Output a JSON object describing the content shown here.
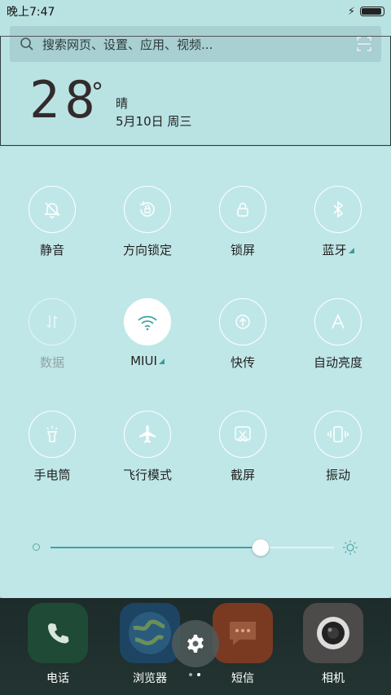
{
  "status": {
    "time": "晚上7:47"
  },
  "search": {
    "placeholder": "搜索网页、设置、应用、视频..."
  },
  "weather": {
    "temperature": "28",
    "condition": "晴",
    "date": "5月10日 周三"
  },
  "toggles": [
    {
      "label": "静音",
      "icon": "bell-off-icon",
      "state": "off"
    },
    {
      "label": "方向锁定",
      "icon": "rotation-lock-icon",
      "state": "off"
    },
    {
      "label": "锁屏",
      "icon": "lock-icon",
      "state": "off"
    },
    {
      "label": "蓝牙",
      "icon": "bluetooth-icon",
      "state": "off"
    },
    {
      "label": "数据",
      "icon": "mobile-data-icon",
      "state": "disabled"
    },
    {
      "label": "MIUI",
      "icon": "wifi-icon",
      "state": "on"
    },
    {
      "label": "快传",
      "icon": "quick-transfer-icon",
      "state": "off"
    },
    {
      "label": "自动亮度",
      "icon": "auto-brightness-icon",
      "state": "off"
    },
    {
      "label": "手电筒",
      "icon": "flashlight-icon",
      "state": "off"
    },
    {
      "label": "飞行模式",
      "icon": "airplane-icon",
      "state": "off"
    },
    {
      "label": "截屏",
      "icon": "screenshot-icon",
      "state": "off"
    },
    {
      "label": "振动",
      "icon": "vibrate-icon",
      "state": "off"
    }
  ],
  "brightness": {
    "level": 0.74
  },
  "dock": [
    {
      "label": "电话",
      "icon": "phone-icon",
      "color": "#1f5a3c"
    },
    {
      "label": "浏览器",
      "icon": "globe-icon",
      "color": "#1e4a66"
    },
    {
      "label": "短信",
      "icon": "message-icon",
      "color": "#8a4a2a"
    },
    {
      "label": "相机",
      "icon": "camera-icon",
      "color": "#4a4a4a"
    }
  ],
  "colors": {
    "accent": "#3fa3a3",
    "panel": "#c0e7e8"
  }
}
